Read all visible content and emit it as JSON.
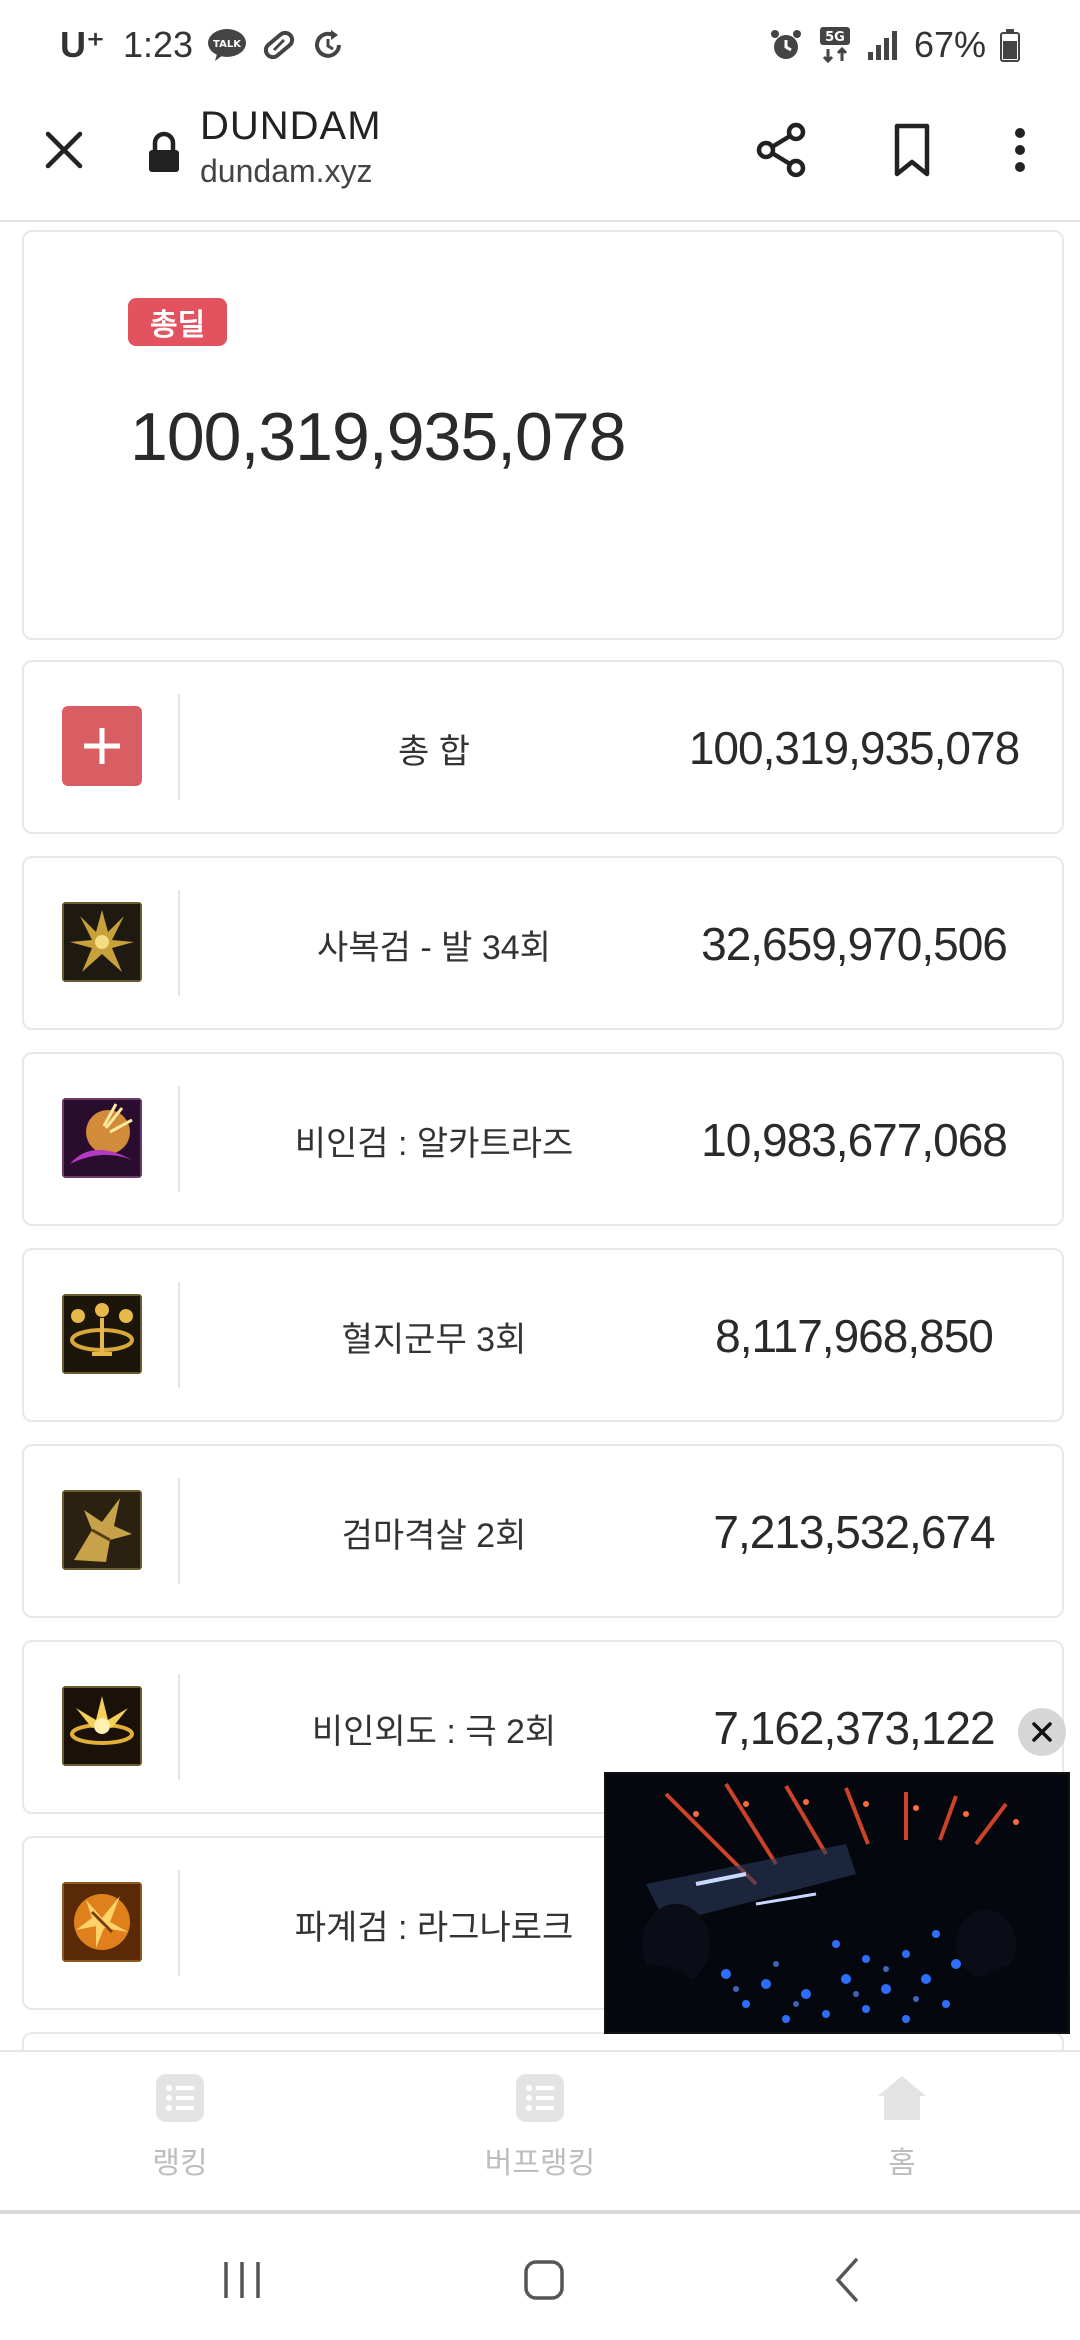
{
  "status_bar": {
    "carrier": "U⁺",
    "time": "1:23",
    "battery": "67%",
    "network": "5G"
  },
  "browser": {
    "site_title": "DUNDAM",
    "site_url": "dundam.xyz"
  },
  "total": {
    "badge": "총딜",
    "value": "100,319,935,078"
  },
  "skills": [
    {
      "name": "총 합",
      "value": "100,319,935,078",
      "icon": "plus-icon"
    },
    {
      "name": "사복검 - 발 34회",
      "value": "32,659,970,506",
      "icon": "skill-sabokgeom-icon"
    },
    {
      "name": "비인검 : 알카트라즈",
      "value": "10,983,677,068",
      "icon": "skill-alcatraz-icon"
    },
    {
      "name": "혈지군무 3회",
      "value": "8,117,968,850",
      "icon": "skill-hyeoljigunmu-icon"
    },
    {
      "name": "검마격살 2회",
      "value": "7,213,532,674",
      "icon": "skill-geommagyeoksal-icon"
    },
    {
      "name": "비인외도 : 극 2회",
      "value": "7,162,373,122",
      "icon": "skill-biinoedo-icon"
    },
    {
      "name": "파계검 : 라그나로크",
      "value": "",
      "icon": "skill-ragnarok-icon"
    }
  ],
  "bottom_nav": [
    {
      "label": "랭킹",
      "icon": "list-icon"
    },
    {
      "label": "버프랭킹",
      "icon": "list-icon"
    },
    {
      "label": "홈",
      "icon": "home-icon"
    }
  ],
  "colors": {
    "badge_red": "#e2525f",
    "plus_red": "#d95e64",
    "border": "#e8e8e8",
    "nav_label": "#bdbdbd"
  }
}
